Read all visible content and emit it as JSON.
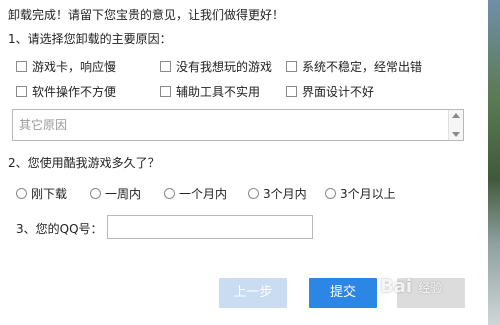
{
  "header": {
    "title": "卸载完成！请留下您宝贵的意见，让我们做得更好！"
  },
  "q1": {
    "label": "1、请选择您卸载的主要原因：",
    "options": [
      "游戏卡，响应慢",
      "没有我想玩的游戏",
      "系统不稳定，经常出错",
      "软件操作不方便",
      "辅助工具不实用",
      "界面设计不好"
    ],
    "other_placeholder": "其它原因"
  },
  "q2": {
    "label": "2、您使用酷我游戏多久了？",
    "options": [
      "刚下载",
      "一周内",
      "一个月内",
      "3个月内",
      "3个月以上"
    ]
  },
  "q3": {
    "label": "3、您的QQ号：",
    "value": ""
  },
  "buttons": {
    "prev": "上一步",
    "submit": "提交",
    "next": ""
  },
  "watermark": {
    "brand": "Bai",
    "text": "经验"
  }
}
